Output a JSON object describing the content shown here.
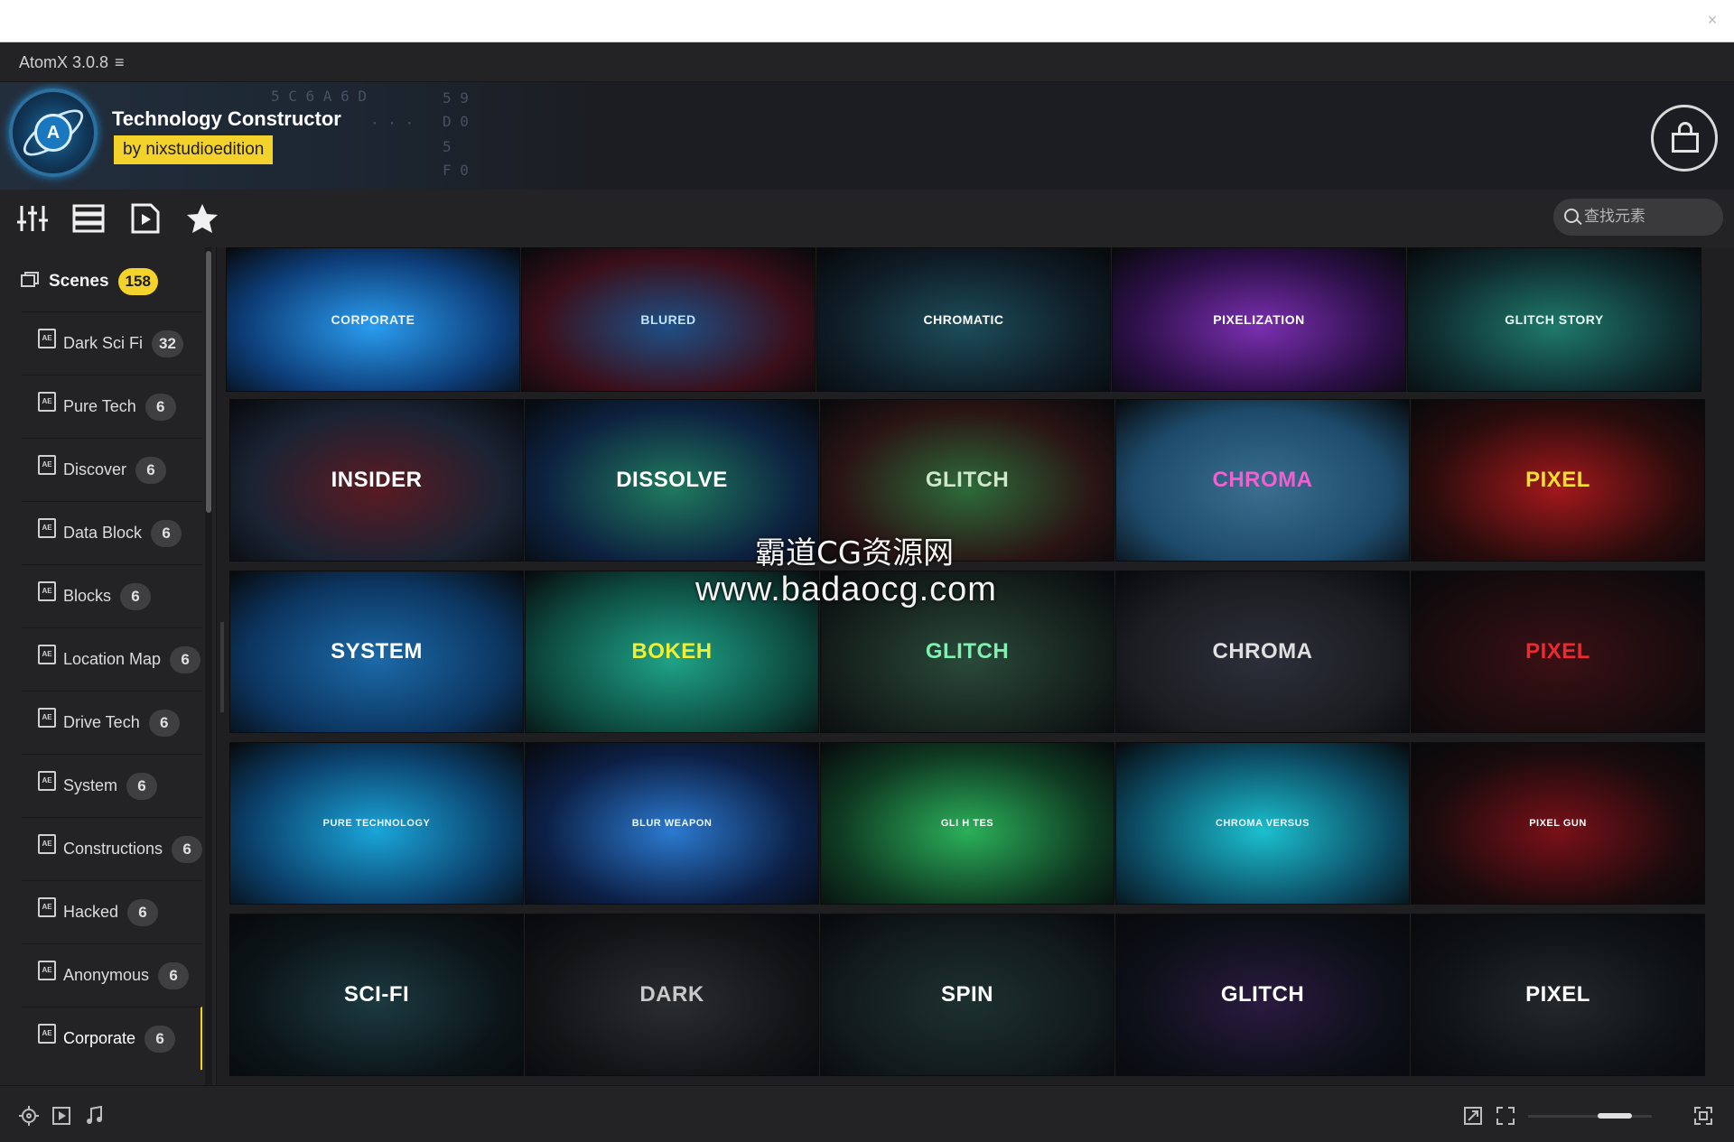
{
  "window": {
    "close": "×"
  },
  "app": {
    "title": "AtomX 3.0.8",
    "menu_icon": "≡"
  },
  "banner": {
    "title": "Technology Constructor",
    "author": "by nixstudioedition"
  },
  "toolbar": {
    "tools": [
      "sliders-icon",
      "list-icon",
      "media-icon",
      "star-icon"
    ],
    "search_placeholder": "查找元素"
  },
  "sidebar": {
    "header": {
      "label": "Scenes",
      "count": "158"
    },
    "items": [
      {
        "label": "Dark Sci Fi",
        "count": "32"
      },
      {
        "label": "Pure Tech",
        "count": "6"
      },
      {
        "label": "Discover",
        "count": "6"
      },
      {
        "label": "Data Block",
        "count": "6"
      },
      {
        "label": "Blocks",
        "count": "6"
      },
      {
        "label": "Location Map",
        "count": "6"
      },
      {
        "label": "Drive Tech",
        "count": "6"
      },
      {
        "label": "System",
        "count": "6"
      },
      {
        "label": "Constructions",
        "count": "6"
      },
      {
        "label": "Hacked",
        "count": "6"
      },
      {
        "label": "Anonymous",
        "count": "6"
      },
      {
        "label": "Corporate",
        "count": "6",
        "active": true
      }
    ]
  },
  "grid": {
    "rows": [
      [
        {
          "title": "CORPORATE",
          "bg": "#0d3d78",
          "accent": "#2a9df0",
          "color": "#e8f4ff"
        },
        {
          "title": "BLURED",
          "bg": "#3a0f1a",
          "accent": "#1e4f86",
          "color": "#bfe2ff"
        },
        {
          "title": "CHROMATIC",
          "bg": "#0f1c26",
          "accent": "#1c4d5a",
          "color": "#ffffff"
        },
        {
          "title": "PIXELIZATION",
          "bg": "#2b0f46",
          "accent": "#7a2fb0",
          "color": "#ffffff"
        },
        {
          "title": "GLITCH STORY",
          "bg": "#0f2a2d",
          "accent": "#1f7a6c",
          "color": "#e6fff7"
        }
      ],
      [
        {
          "title": "INSIDER",
          "bg": "#1a2333",
          "accent": "#5a1a22",
          "color": "#ffffff"
        },
        {
          "title": "DISSOLVE",
          "bg": "#0d2240",
          "accent": "#1f7a5e",
          "color": "#ffffff"
        },
        {
          "title": "GLITCH",
          "bg": "#2a1414",
          "accent": "#2d6b3a",
          "color": "#cfe9c8"
        },
        {
          "title": "CHROMA",
          "bg": "#1d4a6a",
          "accent": "#3a6f8f",
          "color": "#f25fd0"
        },
        {
          "title": "PIXEL",
          "bg": "#2a0c0c",
          "accent": "#a3181c",
          "color": "#f6e12e"
        }
      ],
      [
        {
          "title": "SYSTEM",
          "bg": "#0c3560",
          "accent": "#1b6aa8",
          "color": "#ffffff"
        },
        {
          "title": "BOKEH",
          "bg": "#0d4a3f",
          "accent": "#1fa388",
          "color": "#f1ef30"
        },
        {
          "title": "GLITCH",
          "bg": "#15201c",
          "accent": "#2a4a3a",
          "color": "#7ff0b0"
        },
        {
          "title": "CHROMA",
          "bg": "#1c1d22",
          "accent": "#2c2f3a",
          "color": "#e0e0e0"
        },
        {
          "title": "PIXEL",
          "bg": "#1a0c0e",
          "accent": "#3a1014",
          "color": "#ee2a2f"
        }
      ],
      [
        {
          "title": "PURE TECHNOLOGY",
          "bg": "#0b3f6a",
          "accent": "#1aa5d8",
          "color": "#e8f7ff"
        },
        {
          "title": "BLUR WEAPON",
          "bg": "#0c1f45",
          "accent": "#2b7ad0",
          "color": "#e8f7ff"
        },
        {
          "title": "GLI  H TES",
          "bg": "#0f3a22",
          "accent": "#2bb05a",
          "color": "#ffffff"
        },
        {
          "title": "CHROMA VERSUS",
          "bg": "#0c4a62",
          "accent": "#1bc0cf",
          "color": "#e8f7ff"
        },
        {
          "title": "PIXEL GUN",
          "bg": "#1a0b0d",
          "accent": "#7a1018",
          "color": "#ffffff"
        }
      ],
      [
        {
          "title": "SCI-FI",
          "bg": "#0c1519",
          "accent": "#1b3a40",
          "color": "#ffffff"
        },
        {
          "title": "DARK",
          "bg": "#121416",
          "accent": "#2a2d30",
          "color": "#c9c9c9"
        },
        {
          "title": "SPIN",
          "bg": "#121a1b",
          "accent": "#1d3030",
          "color": "#ffffff"
        },
        {
          "title": "GLITCH",
          "bg": "#0d1018",
          "accent": "#2a1a40",
          "color": "#ffffff"
        },
        {
          "title": "PIXEL",
          "bg": "#0f1214",
          "accent": "#23282d",
          "color": "#ffffff"
        }
      ]
    ]
  },
  "watermark": {
    "line1": "霸道CG资源网",
    "line2": "www.badaocg.com"
  },
  "bottom_bar": {
    "left_icons": [
      "target-icon",
      "play-box-icon",
      "music-note-icon"
    ],
    "right_icons": [
      "expand-icon",
      "fullscreen-icon",
      "grid-size-icon"
    ],
    "zoom_fraction": 0.7
  }
}
